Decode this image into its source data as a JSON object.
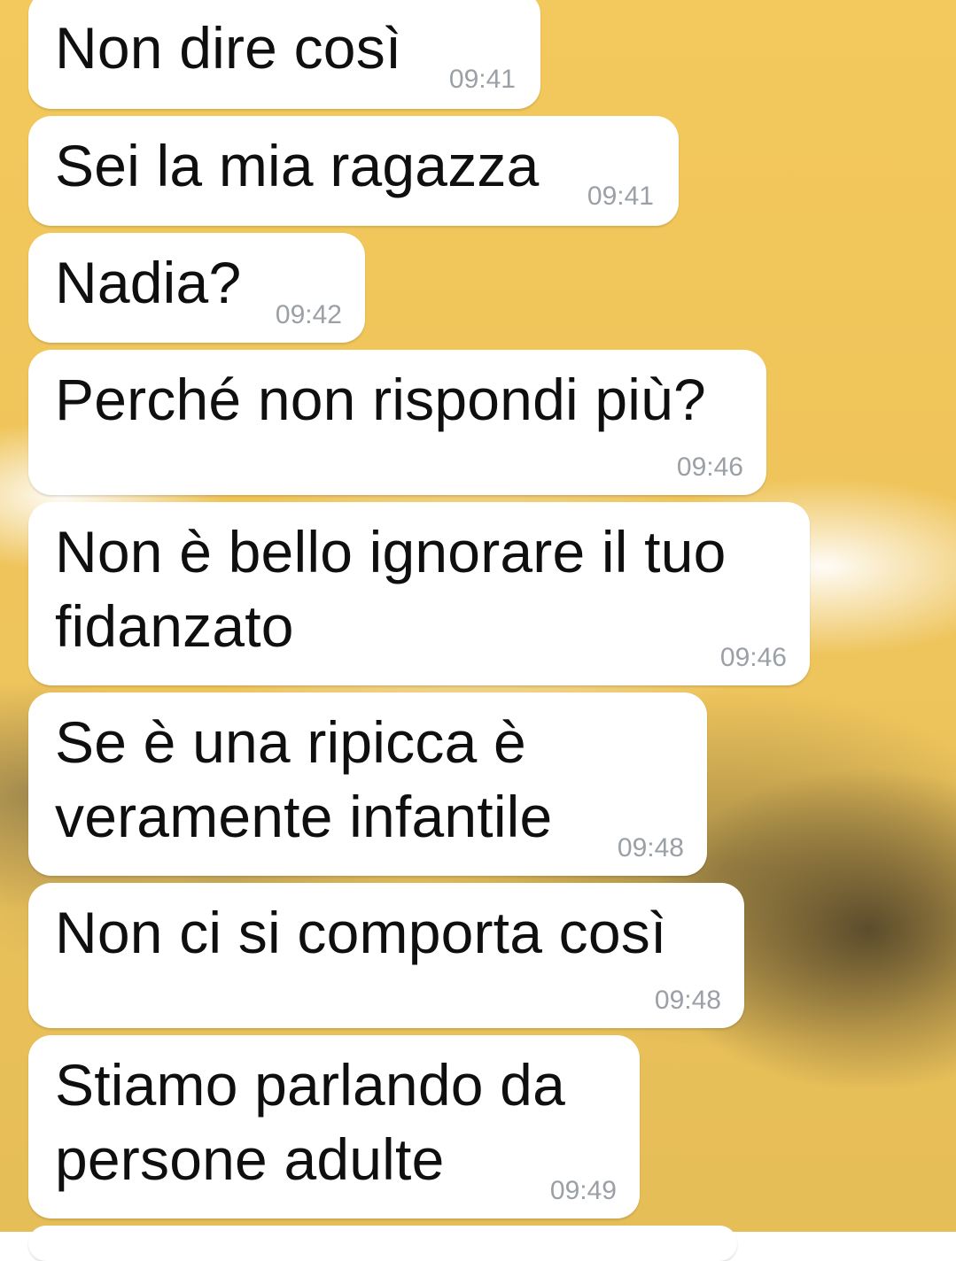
{
  "chat": {
    "messages": [
      {
        "text": "Non dire così",
        "time": "09:41"
      },
      {
        "text": "Sei la mia ragazza",
        "time": "09:41"
      },
      {
        "text": "Nadia?",
        "time": "09:42"
      },
      {
        "text": "Perché non rispondi più?",
        "time": "09:46"
      },
      {
        "text": "Non è bello ignorare il tuo\nfidanzato",
        "time": "09:46"
      },
      {
        "text": "Se è una ripicca è\nveramente infantile",
        "time": "09:48"
      },
      {
        "text": "Non ci si comporta così",
        "time": "09:48"
      },
      {
        "text": "Stiamo parlando da\npersone adulte",
        "time": "09:49"
      }
    ]
  }
}
